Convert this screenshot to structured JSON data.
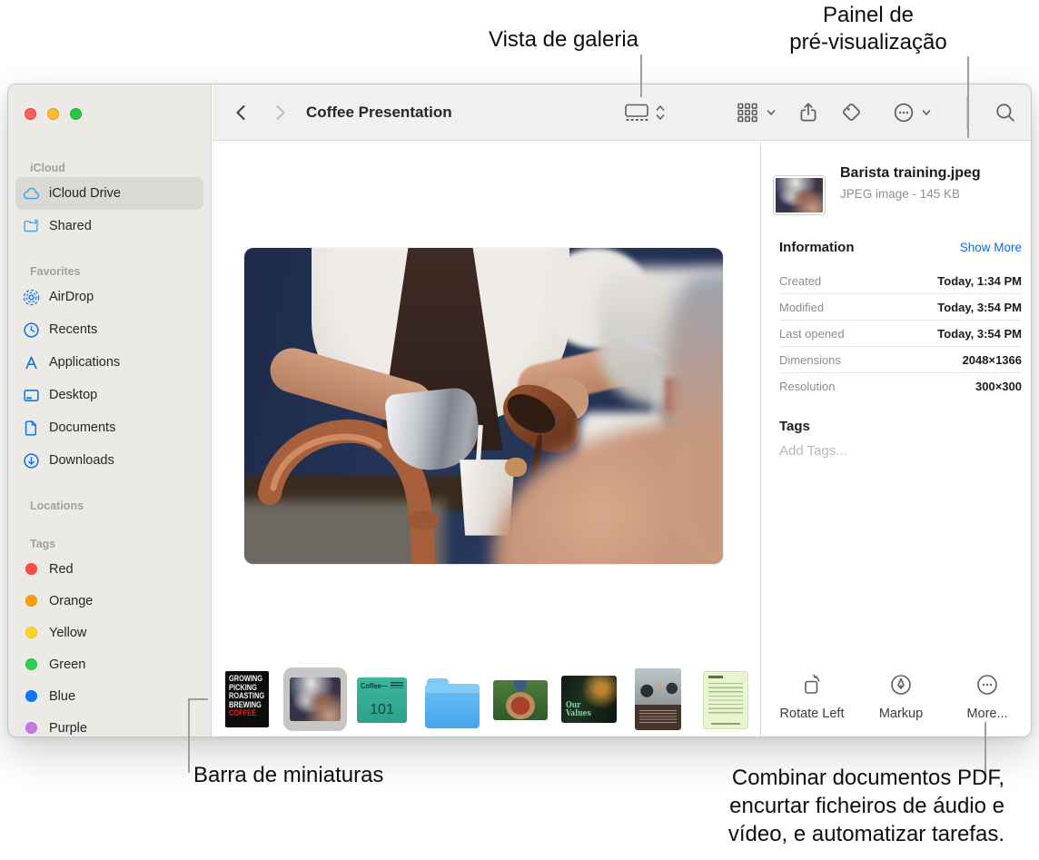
{
  "callouts": {
    "gallery_view": "Vista de galeria",
    "preview_pane_line1": "Painel de",
    "preview_pane_line2": "pré-visualização",
    "thumbnail_bar": "Barra de miniaturas",
    "more_actions_line1": "Combinar documentos PDF,",
    "more_actions_line2": "encurtar ficheiros de áudio e",
    "more_actions_line3": "vídeo, e automatizar tarefas."
  },
  "window": {
    "toolbar": {
      "title": "Coffee Presentation",
      "icons": [
        "back",
        "forward",
        "gallery-view",
        "group",
        "share",
        "tags",
        "more",
        "search"
      ]
    },
    "sidebar": {
      "sections": [
        {
          "header": "iCloud",
          "items": [
            {
              "label": "iCloud Drive",
              "icon": "icloud-drive-cloud",
              "selected": true
            },
            {
              "label": "Shared",
              "icon": "shared-folder"
            }
          ]
        },
        {
          "header": "Favorites",
          "items": [
            {
              "label": "AirDrop",
              "icon": "airdrop"
            },
            {
              "label": "Recents",
              "icon": "clock"
            },
            {
              "label": "Applications",
              "icon": "applications"
            },
            {
              "label": "Desktop",
              "icon": "desktop"
            },
            {
              "label": "Documents",
              "icon": "document"
            },
            {
              "label": "Downloads",
              "icon": "downloads"
            }
          ]
        },
        {
          "header": "Locations",
          "items": []
        },
        {
          "header": "Tags",
          "items": [
            {
              "label": "Red",
              "color": "#ff4b40"
            },
            {
              "label": "Orange",
              "color": "#ff9d0a"
            },
            {
              "label": "Yellow",
              "color": "#ffd426"
            },
            {
              "label": "Green",
              "color": "#2bd14e"
            },
            {
              "label": "Blue",
              "color": "#0c79ff"
            },
            {
              "label": "Purple",
              "color": "#c478e8"
            }
          ]
        }
      ]
    },
    "preview_pane": {
      "file_name": "Barista training.jpeg",
      "file_meta": "JPEG image - 145 KB",
      "info_header": "Information",
      "show_more": "Show More",
      "info_rows": [
        {
          "label": "Created",
          "value": "Today, 1:34 PM"
        },
        {
          "label": "Modified",
          "value": "Today, 3:54 PM"
        },
        {
          "label": "Last opened",
          "value": "Today, 3:54 PM"
        },
        {
          "label": "Dimensions",
          "value": "2048×1366"
        },
        {
          "label": "Resolution",
          "value": "300×300"
        }
      ],
      "tags_header": "Tags",
      "add_tags_placeholder": "Add Tags...",
      "quick_actions": [
        {
          "label": "Rotate Left",
          "icon": "rotate-left"
        },
        {
          "label": "Markup",
          "icon": "markup-pen"
        },
        {
          "label": "More...",
          "icon": "more-ellipsis"
        }
      ]
    },
    "thumbnails": {
      "poster_lines": [
        "GROWING",
        "PICKING",
        "ROASTING",
        "BREWING",
        "COFFEE"
      ],
      "coffee_card_title": "Coffee—",
      "coffee_card_number": "101",
      "values_line1": "Our",
      "values_line2": "Values"
    },
    "colors": {
      "accent_blue": "#0d6ce4",
      "sidebar_icon_blue": "#0f74ee",
      "icloud_icon_blue": "#44a6e2"
    }
  }
}
